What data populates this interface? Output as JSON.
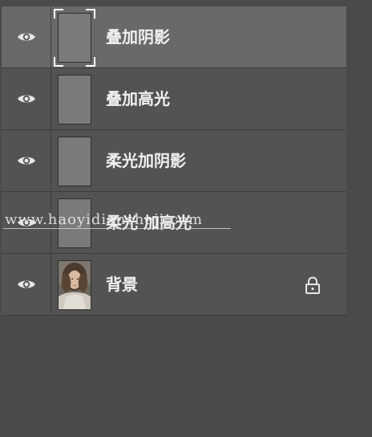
{
  "layers": [
    {
      "name": "叠加阴影",
      "selected": true,
      "type": "fill"
    },
    {
      "name": "叠加高光",
      "selected": false,
      "type": "fill"
    },
    {
      "name": "柔光加阴影",
      "selected": false,
      "type": "fill"
    },
    {
      "name": "柔光 加高光",
      "selected": false,
      "type": "fill"
    },
    {
      "name": "背景",
      "selected": false,
      "type": "photo",
      "locked": true
    }
  ],
  "icons": {
    "visibility": "eye-icon",
    "lock": "lock-icon"
  },
  "colors": {
    "panel_bg": "#535353",
    "selected_bg": "#696969",
    "text": "#f0f0f0",
    "thumb_fill": "#7a7a7a"
  },
  "watermark": {
    "text": "www.haoyidiansheji.com"
  }
}
